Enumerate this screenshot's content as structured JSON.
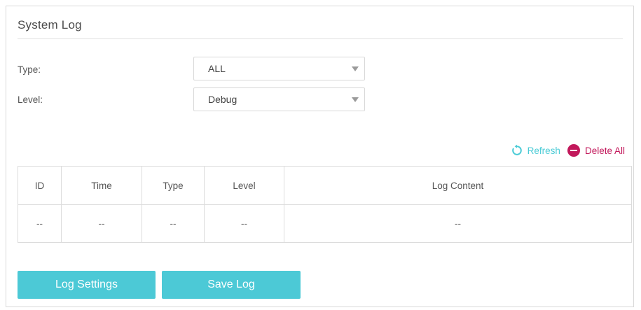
{
  "page": {
    "title": "System Log"
  },
  "filters": {
    "type_label": "Type:",
    "type_value": "ALL",
    "level_label": "Level:",
    "level_value": "Debug"
  },
  "actions": {
    "refresh_label": "Refresh",
    "delete_all_label": "Delete All",
    "refresh_color": "#4acbd6",
    "delete_color": "#c2185b"
  },
  "log_table": {
    "columns": [
      "ID",
      "Time",
      "Type",
      "Level",
      "Log Content"
    ],
    "rows": [
      [
        "--",
        "--",
        "--",
        "--",
        "--"
      ]
    ]
  },
  "buttons": {
    "log_settings_label": "Log Settings",
    "save_log_label": "Save Log",
    "color": "#4cc9d6"
  },
  "icons": {
    "refresh": "refresh-icon",
    "delete": "delete-all-icon",
    "dropdown": "chevron-down-icon"
  }
}
